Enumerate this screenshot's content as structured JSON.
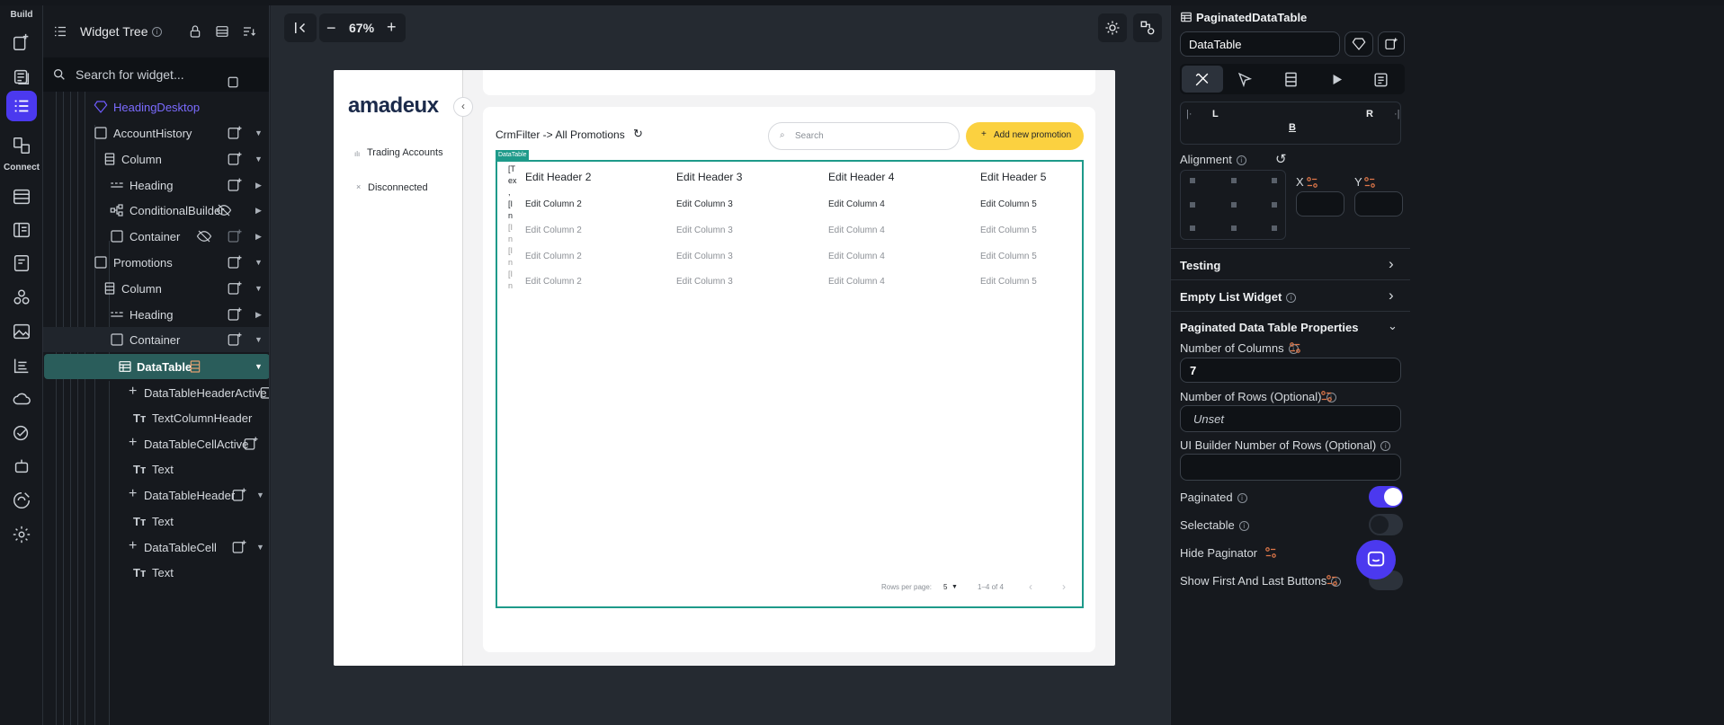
{
  "rail": {
    "build_label": "Build",
    "connect_label": "Connect",
    "items": [
      {
        "icon": "add-page-icon"
      },
      {
        "icon": "page-selector-icon"
      },
      {
        "icon": "widget-tree-icon",
        "active": true
      },
      {
        "icon": "storyboard-icon"
      },
      {
        "icon": "firestore-icon"
      },
      {
        "icon": "app-state-icon"
      },
      {
        "icon": "media-assets-icon"
      },
      {
        "icon": "custom-code-icon"
      },
      {
        "icon": "image-assets-icon"
      },
      {
        "icon": "app-values-icon"
      },
      {
        "icon": "cloud-functions-icon"
      },
      {
        "icon": "test-icon"
      },
      {
        "icon": "agents-icon"
      },
      {
        "icon": "integrations-icon"
      },
      {
        "icon": "settings-icon"
      }
    ]
  },
  "tree": {
    "title": "Widget Tree",
    "search_placeholder": "Search for widget...",
    "items": [
      {
        "label": "HeadingDesktop"
      },
      {
        "label": "AccountHistory"
      },
      {
        "label": "Column"
      },
      {
        "label": "Heading"
      },
      {
        "label": "ConditionalBuilder"
      },
      {
        "label": "Container"
      },
      {
        "label": "Promotions"
      },
      {
        "label": "Column"
      },
      {
        "label": "Heading"
      },
      {
        "label": "Container"
      },
      {
        "label": "DataTable"
      },
      {
        "label": "DataTableHeaderActive"
      },
      {
        "label": "TextColumnHeader"
      },
      {
        "label": "DataTableCellActive"
      },
      {
        "label": "Text"
      },
      {
        "label": "DataTableHeader"
      },
      {
        "label": "Text"
      },
      {
        "label": "DataTableCell"
      },
      {
        "label": "Text"
      }
    ]
  },
  "canvas": {
    "zoom": "67%",
    "minus": "−",
    "plus": "+",
    "app": {
      "logo": "amadeux",
      "nav": [
        {
          "icon": "bar-chart-icon",
          "label": "Trading Accounts"
        },
        {
          "icon": "x-icon",
          "label": "Disconnected"
        }
      ],
      "breadcrumb": "CrmFilter -> All Promotions",
      "search_placeholder": "Search",
      "add_button": "Add new promotion",
      "badge": "DataTable",
      "overflow_text": [
        "[T",
        "ex",
        ",",
        "[I",
        "n",
        "[I",
        "n",
        "[I",
        "n",
        "[I",
        "n"
      ],
      "headers": [
        "Edit Header 2",
        "Edit Header 3",
        "Edit Header 4",
        "Edit Header 5"
      ],
      "rows": [
        [
          "Edit Column 2",
          "Edit Column 3",
          "Edit Column 4",
          "Edit Column 5"
        ],
        [
          "Edit Column 2",
          "Edit Column 3",
          "Edit Column 4",
          "Edit Column 5"
        ],
        [
          "Edit Column 2",
          "Edit Column 3",
          "Edit Column 4",
          "Edit Column 5"
        ],
        [
          "Edit Column 2",
          "Edit Column 3",
          "Edit Column 4",
          "Edit Column 5"
        ]
      ],
      "rows_per_page_label": "Rows per page:",
      "rows_per_page": "5",
      "range": "1–4 of 4"
    }
  },
  "panel": {
    "widget_type": "PaginatedDataTable",
    "widget_name": "DataTable",
    "padding_labels": {
      "l": "L",
      "r": "R",
      "b": "B"
    },
    "alignment_label": "Alignment",
    "x_label": "X",
    "y_label": "Y",
    "testing": "Testing",
    "empty_list": "Empty List Widget",
    "section": "Paginated Data Table Properties",
    "num_columns_label": "Number of Columns",
    "num_columns": "7",
    "num_rows_label": "Number of Rows (Optional)",
    "num_rows_placeholder": "Unset",
    "ui_rows_label": "UI Builder Number of Rows (Optional)",
    "paginated_label": "Paginated",
    "paginated": true,
    "selectable_label": "Selectable",
    "selectable": false,
    "hide_paginator_label": "Hide Paginator",
    "first_last_label": "Show First And Last Buttons",
    "info_glyph": "i"
  },
  "colors": {
    "accent": "#4b39ef",
    "teal": "#1e9a8a",
    "yellow": "#fbd140",
    "selected_row": "#2a5d5b"
  }
}
